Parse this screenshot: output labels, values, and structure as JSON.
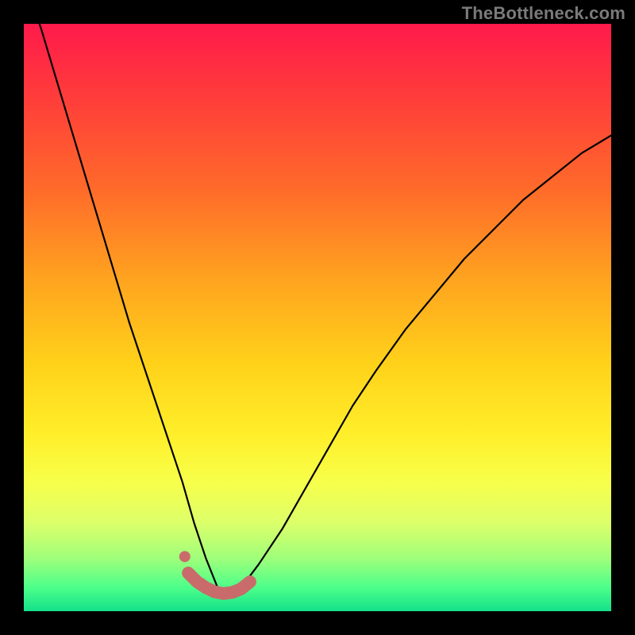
{
  "watermark": "TheBottleneck.com",
  "colors": {
    "frame": "#000000",
    "curve_stroke": "#000000",
    "marker_stroke": "#c96b6b",
    "marker_fill": "#c96b6b"
  },
  "chart_data": {
    "type": "line",
    "title": "",
    "xlabel": "",
    "ylabel": "",
    "xlim": [
      0,
      100
    ],
    "ylim": [
      0,
      100
    ],
    "grid": false,
    "note": "Axes are unlabeled; x/y expressed as 0–100 percent of the plot area (0,0 = bottom-left). Curve resembles a bottleneck/V-shape with minimum near x≈33.",
    "series": [
      {
        "name": "bottleneck-curve",
        "x": [
          0,
          3,
          6,
          9,
          12,
          15,
          18,
          21,
          24,
          27,
          29,
          31,
          33,
          35,
          37,
          40,
          44,
          48,
          52,
          56,
          60,
          65,
          70,
          75,
          80,
          85,
          90,
          95,
          100
        ],
        "y": [
          108,
          99,
          89,
          79,
          69,
          59,
          49,
          40,
          31,
          22,
          15,
          9,
          4,
          3,
          4,
          8,
          14,
          21,
          28,
          35,
          41,
          48,
          54,
          60,
          65,
          70,
          74,
          78,
          81
        ]
      }
    ],
    "markers": {
      "name": "highlight-near-minimum",
      "x": [
        28,
        29.5,
        31,
        32.5,
        34,
        35.5,
        37,
        38.5
      ],
      "y": [
        6.5,
        5.0,
        4.0,
        3.3,
        3.0,
        3.2,
        3.8,
        5.0
      ]
    }
  }
}
